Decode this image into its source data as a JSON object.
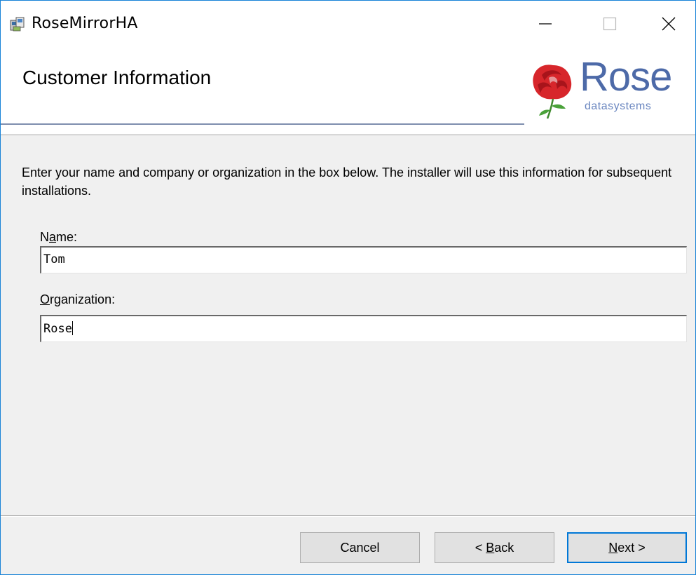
{
  "window": {
    "title": "RoseMirrorHA",
    "icon": "installer-package-icon",
    "controls": {
      "minimize": "minimize-icon",
      "maximize": "maximize-icon",
      "close": "close-icon"
    }
  },
  "banner": {
    "title": "Customer Information",
    "logo": {
      "word": "Rose",
      "subtitle": "datasystems",
      "colors": {
        "rose": "#d7262b",
        "text": "#4d6aa8"
      }
    }
  },
  "body": {
    "intro": "Enter your name and company or organization in the box below. The installer will use this information for subsequent installations."
  },
  "form": {
    "name": {
      "label_pre": "N",
      "label_mnemonic": "a",
      "label_post": "me:",
      "value": "Tom"
    },
    "organization": {
      "label_pre": "",
      "label_mnemonic": "O",
      "label_post": "rganization:",
      "value": "Rose"
    }
  },
  "buttons": {
    "cancel": {
      "label": "Cancel"
    },
    "back": {
      "prefix": "< ",
      "mnemonic": "B",
      "rest": "ack"
    },
    "next": {
      "mnemonic": "N",
      "rest": "ext >"
    }
  },
  "colors": {
    "accent": "#0078d7",
    "window_border": "#1883d7",
    "background": "#f0f0f0"
  }
}
